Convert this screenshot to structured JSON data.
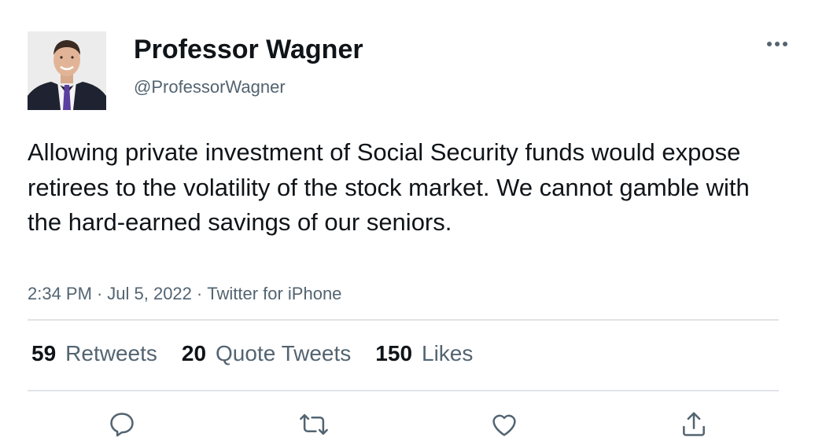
{
  "author": {
    "display_name": "Professor Wagner",
    "handle": "@ProfessorWagner",
    "avatar_icon": "profile-photo"
  },
  "tweet": {
    "text": "Allowing private investment of Social Security funds would expose retirees to the volatility of the stock market. We cannot gamble with the hard-earned savings of our seniors.",
    "time": "2:34 PM",
    "date": "Jul 5, 2022",
    "source": "Twitter for iPhone",
    "separator": "·"
  },
  "stats": {
    "retweets_count": "59",
    "retweets_label": "Retweets",
    "quotes_count": "20",
    "quotes_label": "Quote Tweets",
    "likes_count": "150",
    "likes_label": "Likes"
  },
  "actions": {
    "reply_icon": "reply-icon",
    "retweet_icon": "retweet-icon",
    "like_icon": "heart-icon",
    "share_icon": "share-icon",
    "more_icon": "more-icon"
  },
  "colors": {
    "text_primary": "#0f1419",
    "text_secondary": "#536471",
    "divider": "#e1e4e8",
    "icon": "#536471"
  }
}
